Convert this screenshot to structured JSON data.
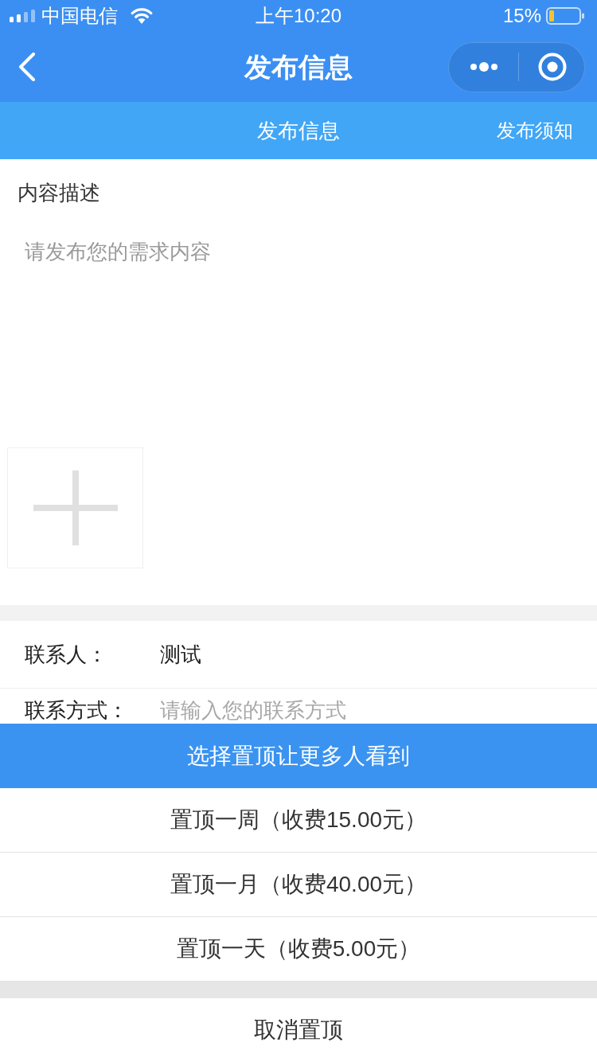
{
  "status_bar": {
    "carrier": "中国电信",
    "time": "上午10:20",
    "battery": "15%"
  },
  "nav_bar": {
    "title": "发布信息"
  },
  "sub_header": {
    "title": "发布信息",
    "link": "发布须知"
  },
  "description": {
    "label": "内容描述",
    "placeholder": "请发布您的需求内容"
  },
  "contact_fields": [
    {
      "label": "联系人：",
      "value": "测试"
    },
    {
      "label": "联系方式：",
      "placeholder": "请输入您的联系方式"
    }
  ],
  "action_sheet": {
    "title": "选择置顶让更多人看到",
    "options": [
      "置顶一周（收费15.00元）",
      "置顶一月（收费40.00元）",
      "置顶一天（收费5.00元）"
    ],
    "cancel": "取消置顶"
  }
}
